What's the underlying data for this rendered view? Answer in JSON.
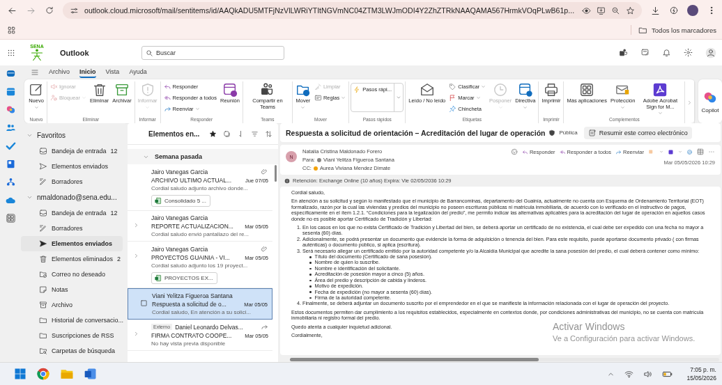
{
  "browser": {
    "url": "outlook.cloud.microsoft/mail/sentitems/id/AAQkADU5MTFjNzVlLWRiYTItNGVmNC04ZTM3LWJmODI4Y2ZhZTRkNAAQAMA567HrmkVOqPLwB61p...",
    "bookmarks": "Todos los marcadores"
  },
  "app": {
    "logo_text": "SENA",
    "name": "Outlook",
    "search": {
      "placeholder": "Buscar"
    }
  },
  "ribbon_tabs": [
    {
      "label": "Archivo",
      "selected": false
    },
    {
      "label": "Inicio",
      "selected": true
    },
    {
      "label": "Vista",
      "selected": false
    },
    {
      "label": "Ayuda",
      "selected": false
    }
  ],
  "ribbon_groups": [
    {
      "label": "Nuevo",
      "columns": [
        [
          {
            "kind": "large",
            "label": "Nuevo",
            "dropdown": true,
            "disabled": false
          }
        ]
      ]
    },
    {
      "label": "Eliminar",
      "columns": [
        [
          {
            "kind": "small",
            "label": "Ignorar",
            "dropdown": false,
            "disabled": true
          },
          {
            "kind": "small",
            "label": "Bloquear",
            "dropdown": true,
            "disabled": true
          }
        ],
        [
          {
            "kind": "large",
            "label": "Eliminar",
            "dropdown": false,
            "disabled": false
          }
        ],
        [
          {
            "kind": "large",
            "label": "Archivar",
            "dropdown": false,
            "disabled": false
          }
        ]
      ]
    },
    {
      "label": "Informar",
      "columns": [
        [
          {
            "kind": "large",
            "label": "Informar",
            "dropdown": true,
            "disabled": true
          }
        ]
      ]
    },
    {
      "label": "Responder",
      "columns": [
        [
          {
            "kind": "small",
            "label": "Responder",
            "dropdown": false,
            "disabled": false
          },
          {
            "kind": "small",
            "label": "Responder a todos",
            "dropdown": false,
            "disabled": false
          },
          {
            "kind": "small",
            "label": "Reenviar",
            "dropdown": true,
            "disabled": false
          }
        ],
        [
          {
            "kind": "large",
            "label": "Reunión",
            "dropdown": false,
            "disabled": false
          }
        ]
      ]
    },
    {
      "label": "Teams",
      "columns": [
        [
          {
            "kind": "large",
            "label": "Compartir en Teams",
            "dropdown": false,
            "disabled": false
          }
        ]
      ]
    },
    {
      "label": "Mover",
      "columns": [
        [
          {
            "kind": "large",
            "label": "Mover",
            "dropdown": true,
            "disabled": false
          }
        ],
        [
          {
            "kind": "small",
            "label": "Limpiar",
            "dropdown": false,
            "disabled": true
          },
          {
            "kind": "small",
            "label": "Reglas",
            "dropdown": true,
            "disabled": false
          }
        ]
      ]
    },
    {
      "label": "Pasos rápidos",
      "columns": [
        [
          {
            "kind": "gallery",
            "label": "Pasos rápi...",
            "dropdown": true,
            "disabled": false
          }
        ]
      ]
    },
    {
      "label": "Etiquetas",
      "columns": [
        [
          {
            "kind": "large",
            "label": "Leído / No leído",
            "dropdown": false,
            "disabled": false
          }
        ],
        [
          {
            "kind": "small",
            "label": "Clasificar",
            "dropdown": true,
            "disabled": false
          },
          {
            "kind": "small",
            "label": "Marcar",
            "dropdown": true,
            "disabled": false
          },
          {
            "kind": "small",
            "label": "Chincheta",
            "dropdown": false,
            "disabled": false
          }
        ],
        [
          {
            "kind": "large",
            "label": "Posponer",
            "dropdown": true,
            "disabled": true
          }
        ],
        [
          {
            "kind": "large",
            "label": "Directiva",
            "dropdown": true,
            "disabled": false
          }
        ]
      ]
    },
    {
      "label": "Imprimir",
      "columns": [
        [
          {
            "kind": "large",
            "label": "Imprimir",
            "dropdown": false,
            "disabled": false
          }
        ]
      ]
    },
    {
      "label": "Complementos",
      "columns": [
        [
          {
            "kind": "large",
            "label": "Más aplicaciones",
            "dropdown": false,
            "disabled": false
          }
        ],
        [
          {
            "kind": "large",
            "label": "Protección",
            "dropdown": true,
            "disabled": false
          }
        ],
        [
          {
            "kind": "large",
            "label": "Adobe Acrobat Sign for M...",
            "dropdown": true,
            "disabled": false
          }
        ]
      ]
    }
  ],
  "copilot": {
    "label": "Copilot"
  },
  "folders": [
    {
      "label": "Favoritos",
      "expanded": true,
      "items": [
        {
          "label": "Bandeja de entrada",
          "count": "12",
          "selected": false
        },
        {
          "label": "Elementos enviados",
          "selected": false
        },
        {
          "label": "Borradores",
          "selected": false
        }
      ]
    },
    {
      "label": "nmaldonado@sena.edu...",
      "expanded": true,
      "items": [
        {
          "label": "Bandeja de entrada",
          "count": "12",
          "selected": false
        },
        {
          "label": "Borradores",
          "selected": false
        },
        {
          "label": "Elementos enviados",
          "selected": true
        },
        {
          "label": "Elementos eliminados",
          "count": "2",
          "selected": false
        },
        {
          "label": "Correo no deseado",
          "selected": false
        },
        {
          "label": "Notas",
          "selected": false
        },
        {
          "label": "Archivo",
          "selected": false
        },
        {
          "label": "Historial de conversacio...",
          "selected": false
        },
        {
          "label": "Suscripciones de RSS",
          "selected": false
        },
        {
          "label": "Carpetas de búsqueda",
          "selected": false
        }
      ]
    }
  ],
  "message_list": {
    "title": "Elementos en...",
    "groups": [
      {
        "label": "Semana pasada",
        "expanded": true,
        "messages": [
          {
            "sender": "Jairo Vanegas Garcia",
            "subject": "ARCHIVO ULTIMO ACTUAL...",
            "date": "Jue 07/05",
            "preview": "Cordial saludo adjunto archivo donde...",
            "chip": "Consolidado 5 ...",
            "thread": false,
            "attachment": true,
            "forwarded": false,
            "selected": false
          },
          {
            "sender": "Jairo Vanegas Garcia",
            "subject": "REPORTE ACTUALIZACION...",
            "date": "Mar 05/05",
            "preview": "Cordial saludo envió pantallazo del re...",
            "thread": true,
            "attachment": false,
            "forwarded": false,
            "selected": false
          },
          {
            "sender": "Jairo Vanegas Garcia",
            "subject": "PROYECTOS GUAINIA - VI...",
            "date": "Mar 05/05",
            "preview": "Cordial saludo adjunto los 19 proyect...",
            "chip": "PROYECTOS EX...",
            "thread": true,
            "attachment": true,
            "forwarded": false,
            "selected": false
          },
          {
            "sender": "Viani Yelitza Figueroa Santana",
            "subject": "Respuesta a solicitud de o...",
            "date": "Mar 05/05",
            "preview": "Cordial saludo, En atención a su solici...",
            "thread": false,
            "attachment": false,
            "forwarded": false,
            "selected": true
          },
          {
            "tag": "Externo",
            "sender": "Daniel Leonardo Delvas...",
            "subject": "FIRMA CONTRATO COOPE...",
            "date": "Mar 05/05",
            "preview": "No hay vista previa disponible",
            "thread": true,
            "attachment": false,
            "forwarded": true,
            "selected": false
          }
        ]
      }
    ]
  },
  "reading": {
    "subject": "Respuesta a solicitud de orientación – Acreditación del lugar de operación",
    "sensitivity": "Pública",
    "summarize": "Resumir este correo electrónico",
    "sender": {
      "initial": "N",
      "name": "Natalia Cristina Maldonado Forero"
    },
    "recipients": [
      {
        "label": "Para:",
        "name": "Viani Yelitza Figueroa Santana",
        "color": "#8a8886"
      },
      {
        "label": "CC:",
        "name": "Aurea Viviana Mendez Dimate",
        "color": "#f2a20c"
      }
    ],
    "actions": [
      "Responder",
      "Responder a todos",
      "Reenviar"
    ],
    "date": "Mar 05/05/2026 10:29",
    "retention": "Retención: Exchange Online (10 años) Expira: Vie 02/05/2036 10:29",
    "body": [
      {
        "kind": "paragraph",
        "text": "Cordial saludo,"
      },
      {
        "kind": "paragraph",
        "text": "En atención a su solicitud y según lo manifestado que el municipio de Barrancominas, departamento del Guainía, actualmente no cuenta con Esquema de Ordenamiento Territorial (EOT) formalizado, razón por la cual las viviendas y predios del municipio no poseen escrituras públicas ni matrícula inmobiliaria, de acuerdo con lo verificado en el instructivo de pagos, específicamente en el ítem 1.2.1. “Condiciones para la legalización del predio”, me permito indicar las alternativas aplicables para la acreditación del lugar de operación en aquellos casos donde no es posible aportar Certificado de Tradición y Libertad:"
      },
      {
        "kind": "ordered_list",
        "items": [
          {
            "marker": "1.",
            "text": "En los casos en los que no exista Certificado de Tradición y Libertad del bien, se deberá aportar un certificado de no existencia, el cual debe ser expedido con una fecha no mayor a sesenta (60) días."
          },
          {
            "marker": "2.",
            "text": "Adicionalmente, se podrá presentar un documento que evidencie la forma de adquisición o tenencia del bien. Para este requisito, puede aportarse documento privado ( con firmas auténticas) o documento público, si aplica (escritura)."
          },
          {
            "marker": "3.",
            "text": "Será necesario allegar un certificado emitido por la autoridad competente y/o la Alcaldía Municipal que acredite la sana posesión del predio, el cual deberá contener como mínimo:",
            "children": [
              "Título del documento (Certificado de sana posesión).",
              "Nombre de quien lo suscribe.",
              "Nombre e identificación del solicitante.",
              "Acreditación de posesión mayor a cinco (5) años.",
              "Área del predio y descripción de cabida y linderos.",
              "Motivo de expedición.",
              "Fecha de expedición (no mayor a sesenta (60) días).",
              "Firma de la autoridad competente."
            ]
          },
          {
            "marker": "4.",
            "text": "Finalmente, se deberá adjuntar un documento suscrito por el emprendedor en el que se manifieste la información relacionada con el lugar de operación del proyecto."
          }
        ]
      },
      {
        "kind": "paragraph",
        "text": "Estos documentos permiten dar cumplimiento a los requisitos establecidos, especialmente en contextos donde, por condiciones administrativas del municipio, no se cuenta con matrícula inmobiliaria ni registro formal del predio."
      },
      {
        "kind": "paragraph",
        "text": "Quedo atenta a cualquier inquietud adicional."
      },
      {
        "kind": "paragraph",
        "text": "Cordialmente,"
      }
    ]
  },
  "windows_notice": {
    "title": "Activar Windows",
    "text": "Ve a Configuración para activar Windows."
  },
  "taskbar": {
    "time": "7:05 p. m.",
    "date": "15/05/2026"
  }
}
